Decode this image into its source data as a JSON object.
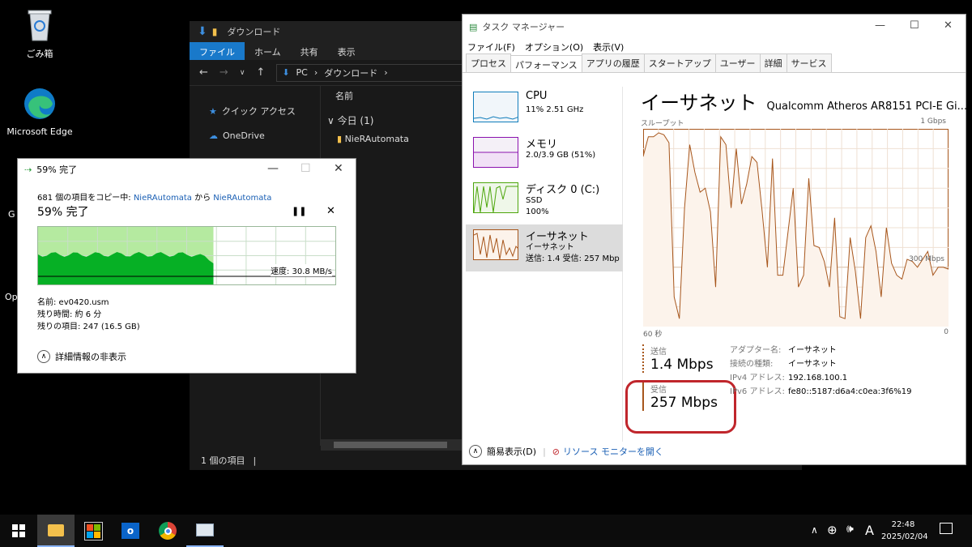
{
  "desktop": {
    "icons": [
      {
        "label": "ごみ箱"
      },
      {
        "label": "Microsoft Edge"
      }
    ],
    "partial_labels": [
      "G",
      "Op"
    ]
  },
  "explorer": {
    "title": "ダウンロード",
    "ribbon_tabs": [
      "ファイル",
      "ホーム",
      "共有",
      "表示"
    ],
    "path": [
      "PC",
      "ダウンロード"
    ],
    "nav": [
      "クイック アクセス",
      "OneDrive"
    ],
    "column_name": "名前",
    "group": "今日 (1)",
    "file": "NieRAutomata",
    "status": "1 個の項目"
  },
  "copy_dialog": {
    "title": "59% 完了",
    "desc_prefix": "681 個の項目をコピー中: ",
    "src": "NieRAutomata",
    "desc_mid": " から ",
    "dst": "NieRAutomata",
    "heading": "59% 完了",
    "progress": 0.59,
    "speed": "速度: 30.8 MB/s",
    "name": "名前:  ev0420.usm",
    "remaining_time": "残り時間:  約 6 分",
    "remaining_items": "残りの項目:  247 (16.5 GB)",
    "details_toggle": "詳細情報の非表示"
  },
  "task_manager": {
    "title": "タスク マネージャー",
    "menu": [
      "ファイル(F)",
      "オプション(O)",
      "表示(V)"
    ],
    "tabs": [
      "プロセス",
      "パフォーマンス",
      "アプリの履歴",
      "スタートアップ",
      "ユーザー",
      "詳細",
      "サービス"
    ],
    "active_tab": "パフォーマンス",
    "side_items": [
      {
        "name": "CPU",
        "line1": "11%  2.51 GHz",
        "line2": ""
      },
      {
        "name": "メモリ",
        "line1": "2.0/3.9 GB (51%)",
        "line2": ""
      },
      {
        "name": "ディスク 0 (C:)",
        "line1": "SSD",
        "line2": "100%"
      },
      {
        "name": "イーサネット",
        "line1": "イーサネット",
        "line2": "送信: 1.4  受信: 257 Mbp"
      }
    ],
    "detail": {
      "title": "イーサネット",
      "adapter_full": "Qualcomm Atheros AR8151 PCI-E Gi...",
      "throughput_label": "スループット",
      "max_label": "1 Gbps",
      "mid_label": "300 Mbps",
      "x_left": "60 秒",
      "x_right": "0",
      "send_label": "送信",
      "send_value": "1.4 Mbps",
      "recv_label": "受信",
      "recv_value": "257 Mbps",
      "props": [
        {
          "k": "アダプター名:",
          "v": "イーサネット"
        },
        {
          "k": "接続の種類:",
          "v": "イーサネット"
        },
        {
          "k": "IPv4 アドレス:",
          "v": "192.168.100.1"
        },
        {
          "k": "IPv6 アドレス:",
          "v": "fe80::5187:d6a4:c0ea:3f6%19"
        }
      ]
    },
    "bottom_simple": "簡易表示(D)",
    "bottom_resmon": "リソース モニターを開く"
  },
  "chart_data": {
    "type": "line",
    "title": "スループット",
    "xlabel": "",
    "ylabel": "",
    "ylim": [
      0,
      1000
    ],
    "xlim": [
      60,
      0
    ],
    "series": [
      {
        "values": [
          860,
          960,
          960,
          980,
          970,
          930,
          150,
          40,
          600,
          920,
          780,
          680,
          700,
          580,
          200,
          960,
          920,
          600,
          900,
          620,
          720,
          860,
          830,
          580,
          300,
          850,
          260,
          260,
          480,
          700,
          200,
          260,
          750,
          410,
          400,
          330,
          200,
          550,
          50,
          40,
          450,
          280,
          40,
          450,
          510,
          380,
          150,
          500,
          320,
          260,
          240,
          340,
          330,
          300,
          340,
          380,
          260,
          300,
          300,
          290
        ]
      }
    ]
  },
  "taskbar": {
    "time": "22:48",
    "date": "2025/02/04",
    "ime": "A"
  },
  "colors": {
    "eth": "#a7561c",
    "eth_fill": "#fcf3eb",
    "cpu": "#117dbb",
    "mem": "#8b12ae",
    "disk": "#4da60c",
    "progress": "#06b025",
    "annotation": "#c0262c"
  }
}
